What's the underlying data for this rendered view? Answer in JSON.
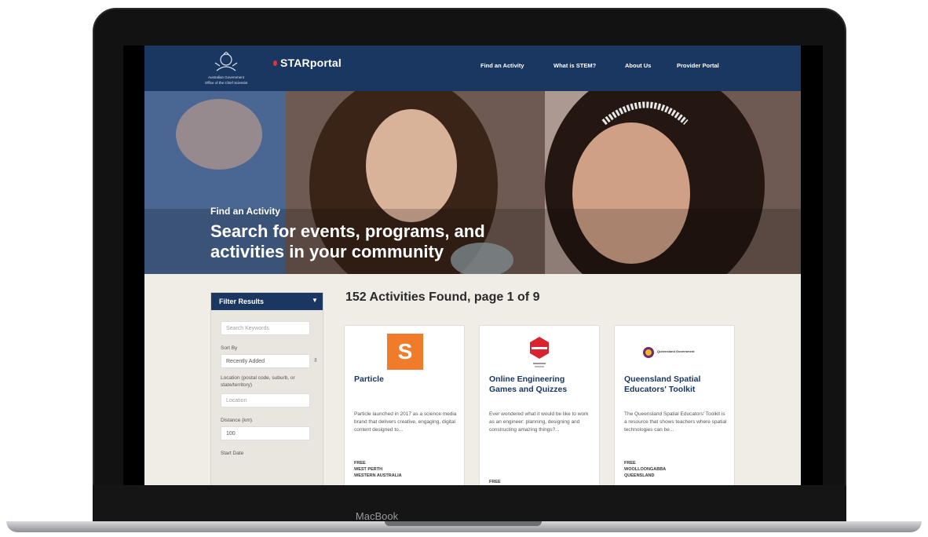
{
  "device": {
    "label": "MacBook"
  },
  "site": {
    "gov_line1": "Australian Government",
    "gov_line2": "Office of the Chief Scientist",
    "logo_text": "STARportal",
    "nav": [
      {
        "label": "Find an Activity"
      },
      {
        "label": "What is STEM?"
      },
      {
        "label": "About Us"
      },
      {
        "label": "Provider Portal"
      }
    ]
  },
  "hero": {
    "eyebrow": "Find an Activity",
    "title": "Search for events, programs, and activities in your community"
  },
  "filter": {
    "header": "Filter Results",
    "keyword_placeholder": "Search Keywords",
    "sort_label": "Sort By",
    "sort_value": "Recently Added",
    "location_label": "Location (postal code, suburb, or state/territory)",
    "location_placeholder": "Location",
    "distance_label": "Distance (km)",
    "distance_value": "100",
    "start_date_label": "Start Date"
  },
  "results": {
    "title": "152 Activities Found, page 1 of 9",
    "cards": [
      {
        "logo_text": "S",
        "title": "Particle",
        "desc": "Particle launched in 2017 as a science media brand that delivers creative, engaging, digital content designed to...",
        "cost": "FREE",
        "location": "WEST PERTH",
        "region": "WESTERN AUSTRALIA"
      },
      {
        "logo_text": "",
        "title": "Online Engineering Games and Quizzes",
        "desc": "Ever wondered what it would be like to work as an engineer: planning, designing and constructing amazing things?...",
        "cost": "FREE",
        "location": "",
        "region": ""
      },
      {
        "logo_text": "Queensland Government",
        "title": "Queensland Spatial Educators' Toolkit",
        "desc": "The Queensland Spatial Educators' Toolkit is a resource that shows teachers where spatial technologies can be...",
        "cost": "FREE",
        "location": "WOOLLOONGABBA",
        "region": "QUEENSLAND"
      }
    ]
  },
  "colors": {
    "navy": "#1a3761",
    "accent_red": "#e0323a",
    "particle_orange": "#f07c2b",
    "page_bg": "#f0ece6"
  }
}
